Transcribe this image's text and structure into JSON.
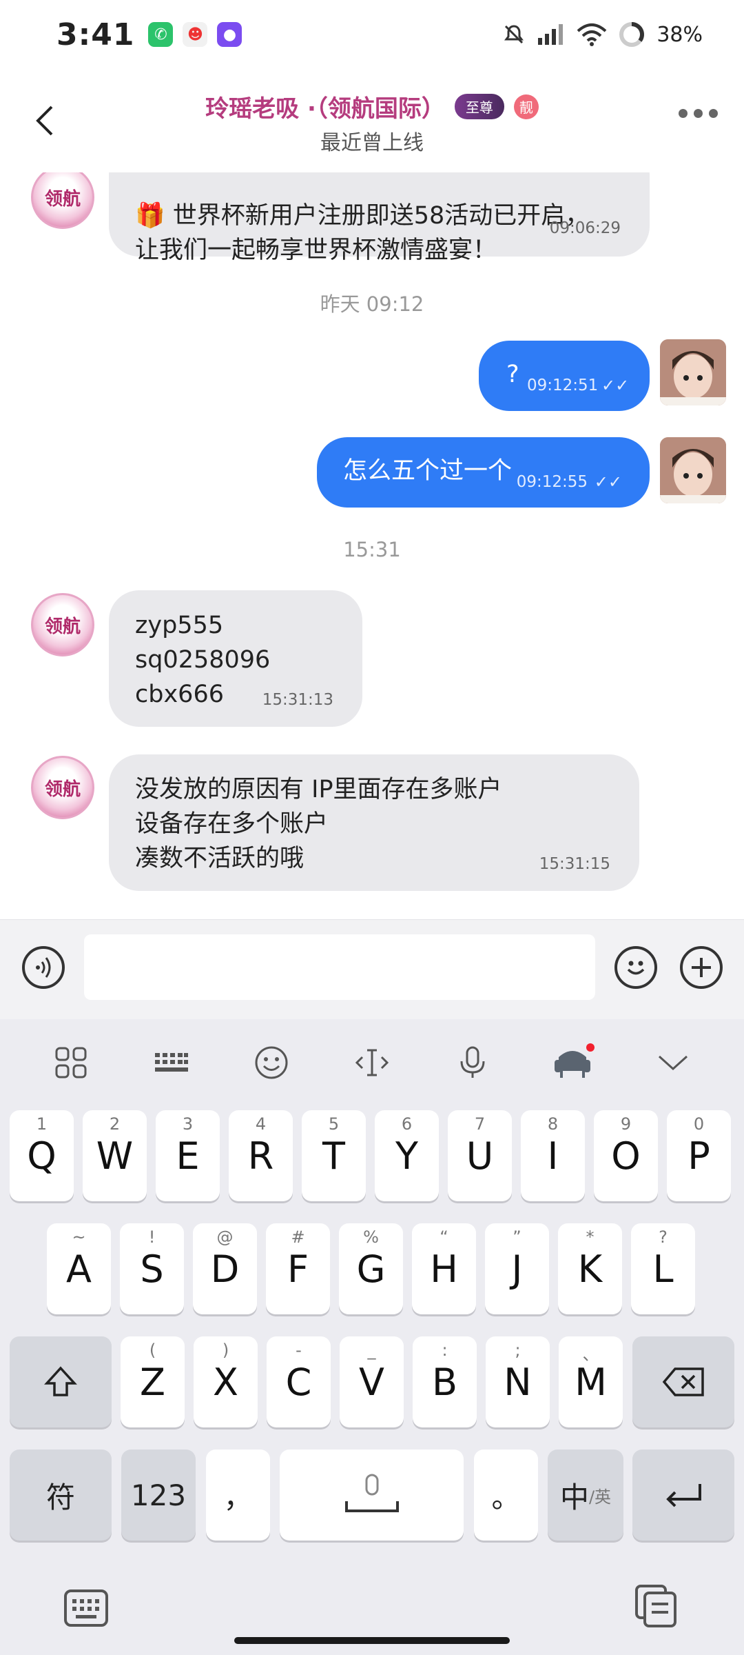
{
  "status": {
    "time": "3:41",
    "battery_text": "38%",
    "icons": [
      "phone-app-icon",
      "clown-app-icon",
      "purple-app-icon",
      "mute-icon",
      "signal-icon",
      "wifi-icon",
      "battery-ring-icon"
    ]
  },
  "header": {
    "title": "玲瑶老吸 ·（领航国际）",
    "badge_primary": "至尊",
    "badge_secondary": "靓",
    "subtitle": "最近曾上线",
    "logo_text": "领航"
  },
  "messages": [
    {
      "id": "m1",
      "direction": "in",
      "lines": [
        "🎁 世界杯新用户注册即送58活动已开启，",
        "让我们一起畅享世界杯激情盛宴！"
      ],
      "time": "09:06:29"
    },
    {
      "id": "d1",
      "divider": "昨天 09:12"
    },
    {
      "id": "m2",
      "direction": "out",
      "text": "?",
      "time": "09:12:51",
      "read": "✓✓"
    },
    {
      "id": "m3",
      "direction": "out",
      "text": "怎么五个过一个",
      "time": "09:12:55",
      "read": "✓✓"
    },
    {
      "id": "d2",
      "divider": "15:31"
    },
    {
      "id": "m4",
      "direction": "in",
      "lines": [
        "zyp555",
        "sq0258096",
        "cbx666"
      ],
      "time": "15:31:13"
    },
    {
      "id": "m5",
      "direction": "in",
      "lines": [
        "没发放的原因有  IP里面存在多账户",
        "设备存在多个账户",
        "凑数不活跃的哦"
      ],
      "time": "15:31:15"
    }
  ],
  "input": {
    "placeholder": ""
  },
  "keyboard": {
    "toolbar": [
      "apps-grid-icon",
      "keyboard-layout-icon",
      "emoji-icon",
      "cursor-icon",
      "mic-icon",
      "skin-icon",
      "collapse-icon"
    ],
    "row1": [
      {
        "k": "Q",
        "s": "1"
      },
      {
        "k": "W",
        "s": "2"
      },
      {
        "k": "E",
        "s": "3"
      },
      {
        "k": "R",
        "s": "4"
      },
      {
        "k": "T",
        "s": "5"
      },
      {
        "k": "Y",
        "s": "6"
      },
      {
        "k": "U",
        "s": "7"
      },
      {
        "k": "I",
        "s": "8"
      },
      {
        "k": "O",
        "s": "9"
      },
      {
        "k": "P",
        "s": "0"
      }
    ],
    "row2": [
      {
        "k": "A",
        "s": "~"
      },
      {
        "k": "S",
        "s": "!"
      },
      {
        "k": "D",
        "s": "@"
      },
      {
        "k": "F",
        "s": "#"
      },
      {
        "k": "G",
        "s": "%"
      },
      {
        "k": "H",
        "s": "“"
      },
      {
        "k": "J",
        "s": "”"
      },
      {
        "k": "K",
        "s": "*"
      },
      {
        "k": "L",
        "s": "?"
      }
    ],
    "row3": [
      {
        "k": "Z",
        "s": "("
      },
      {
        "k": "X",
        "s": ")"
      },
      {
        "k": "C",
        "s": "-"
      },
      {
        "k": "V",
        "s": "_"
      },
      {
        "k": "B",
        "s": ":"
      },
      {
        "k": "N",
        "s": ";"
      },
      {
        "k": "M",
        "s": "、"
      }
    ],
    "fu": "符",
    "num": "123",
    "comma": "，",
    "period": "。",
    "lang_main": "中",
    "lang_sub": "/英"
  },
  "colors": {
    "accent": "#2f7cf6",
    "title": "#b53c7e",
    "keyboard_bg": "#ececf1"
  }
}
